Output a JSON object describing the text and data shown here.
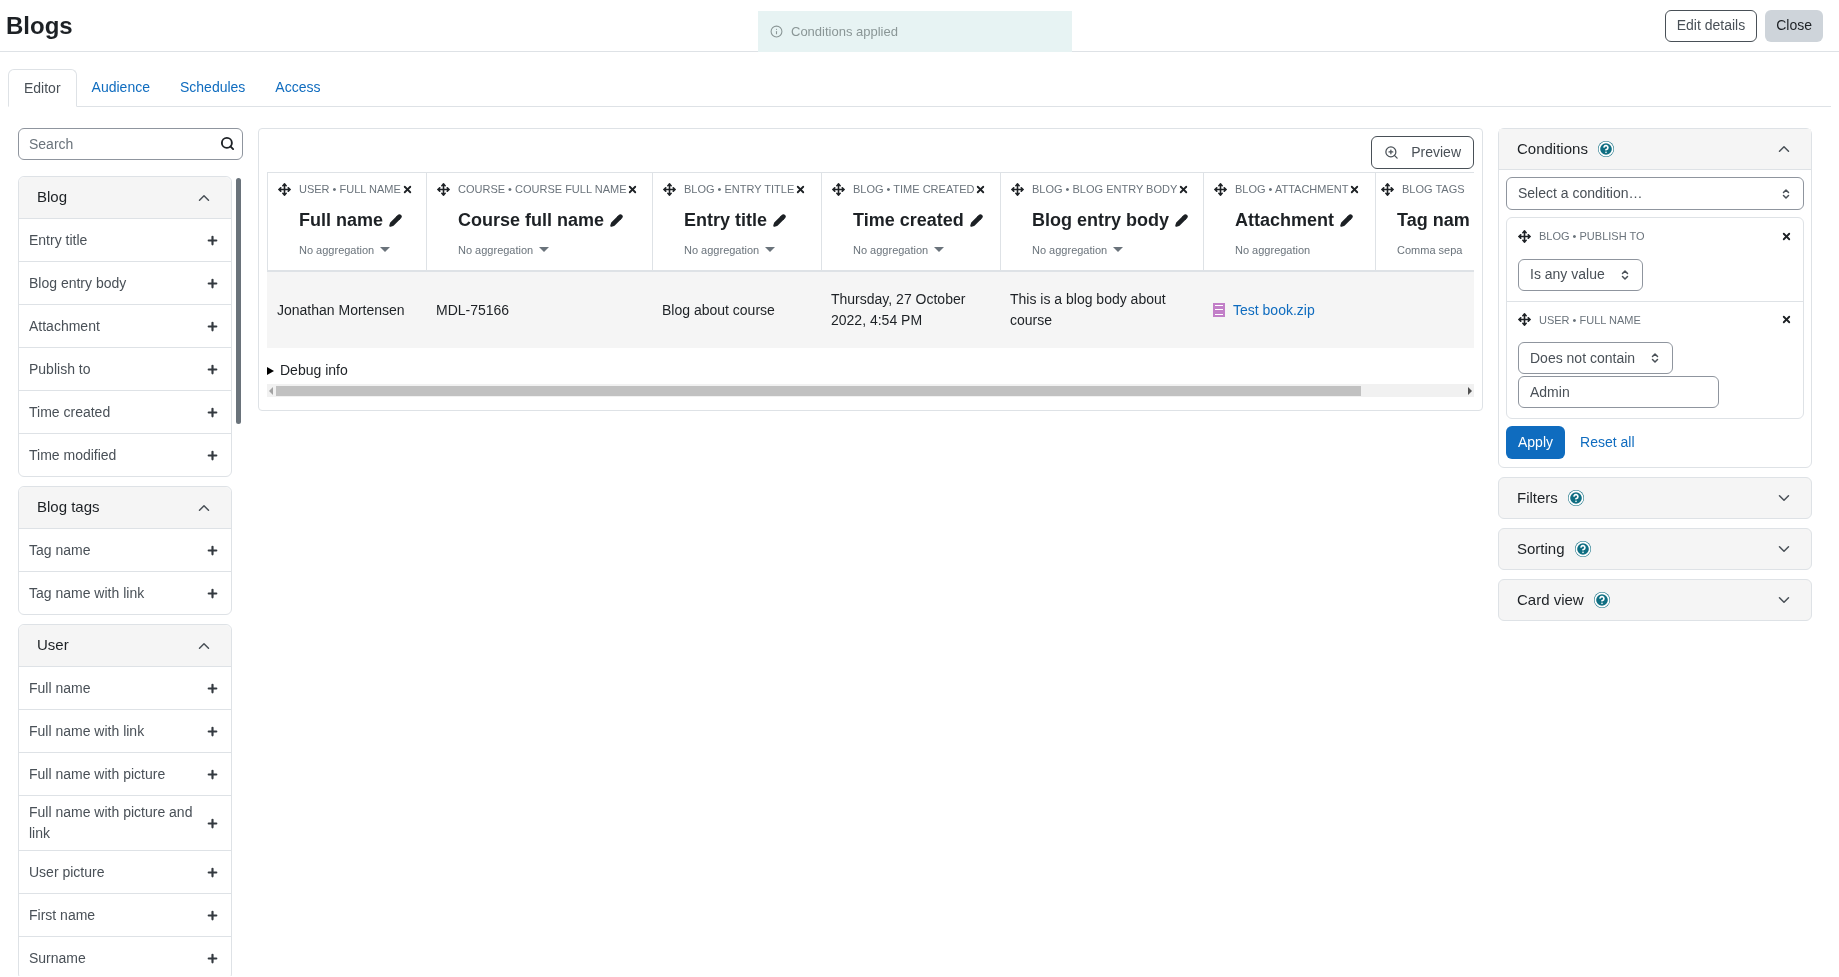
{
  "page_title": "Blogs",
  "toast": {
    "text": "Conditions applied"
  },
  "header_buttons": [
    {
      "label": "Edit details",
      "kind": "outline"
    },
    {
      "label": "Close",
      "kind": "secondary"
    }
  ],
  "tabs": [
    {
      "label": "Editor",
      "selected": true
    },
    {
      "label": "Audience",
      "selected": false
    },
    {
      "label": "Schedules",
      "selected": false
    },
    {
      "label": "Access",
      "selected": false
    }
  ],
  "sidebar": {
    "search": {
      "placeholder": "Search"
    },
    "groups": [
      {
        "title": "Blog",
        "expanded": true,
        "items": [
          "Entry title",
          "Blog entry body",
          "Attachment",
          "Publish to",
          "Time created",
          "Time modified"
        ]
      },
      {
        "title": "Blog tags",
        "expanded": true,
        "items": [
          "Tag name",
          "Tag name with link"
        ]
      },
      {
        "title": "User",
        "expanded": true,
        "items": [
          "Full name",
          "Full name with link",
          "Full name with picture",
          "Full name with picture and link",
          "User picture",
          "First name",
          "Surname"
        ]
      }
    ]
  },
  "report": {
    "preview_button": "Preview",
    "columns": [
      {
        "source": "USER • FULL NAME",
        "title": "Full name",
        "aggregation": "No aggregation",
        "aggregation_menu": true,
        "removable": true,
        "editable": true
      },
      {
        "source": "COURSE • COURSE FULL NAME",
        "title": "Course full name",
        "aggregation": "No aggregation",
        "aggregation_menu": true,
        "removable": true,
        "editable": true
      },
      {
        "source": "BLOG • ENTRY TITLE",
        "title": "Entry title",
        "aggregation": "No aggregation",
        "aggregation_menu": true,
        "removable": true,
        "editable": true
      },
      {
        "source": "BLOG • TIME CREATED",
        "title": "Time created",
        "aggregation": "No aggregation",
        "aggregation_menu": true,
        "removable": true,
        "editable": true
      },
      {
        "source": "BLOG • BLOG ENTRY BODY",
        "title": "Blog entry body",
        "aggregation": "No aggregation",
        "aggregation_menu": true,
        "removable": true,
        "editable": true
      },
      {
        "source": "BLOG • ATTACHMENT",
        "title": "Attachment",
        "aggregation": "No aggregation",
        "aggregation_menu": false,
        "removable": true,
        "editable": true
      },
      {
        "source": "BLOG TAGS",
        "title": "Tag nam",
        "aggregation": "Comma sepa",
        "aggregation_menu": false
      }
    ],
    "rows": [
      [
        {
          "kind": "text",
          "text": "Jonathan Mortensen"
        },
        {
          "kind": "text",
          "text": "MDL-75166"
        },
        {
          "kind": "text",
          "text": "Blog about course"
        },
        {
          "kind": "text",
          "text": "Thursday, 27 October 2022, 4:54 PM"
        },
        {
          "kind": "text",
          "text": "This is a blog body about course"
        },
        {
          "kind": "file",
          "text": "Test book.zip"
        }
      ]
    ],
    "debug": {
      "label": "Debug info",
      "expanded": false
    }
  },
  "conditions": {
    "title": "Conditions",
    "expanded": true,
    "select_placeholder": "Select a condition…",
    "items": [
      {
        "source": "BLOG • PUBLISH TO",
        "operator": "Is any value"
      },
      {
        "source": "USER • FULL NAME",
        "operator": "Does not contain",
        "value": "Admin"
      }
    ],
    "apply": "Apply",
    "reset": "Reset all"
  },
  "sections": [
    {
      "title": "Filters",
      "expanded": false
    },
    {
      "title": "Sorting",
      "expanded": false
    },
    {
      "title": "Card view",
      "expanded": false
    }
  ]
}
